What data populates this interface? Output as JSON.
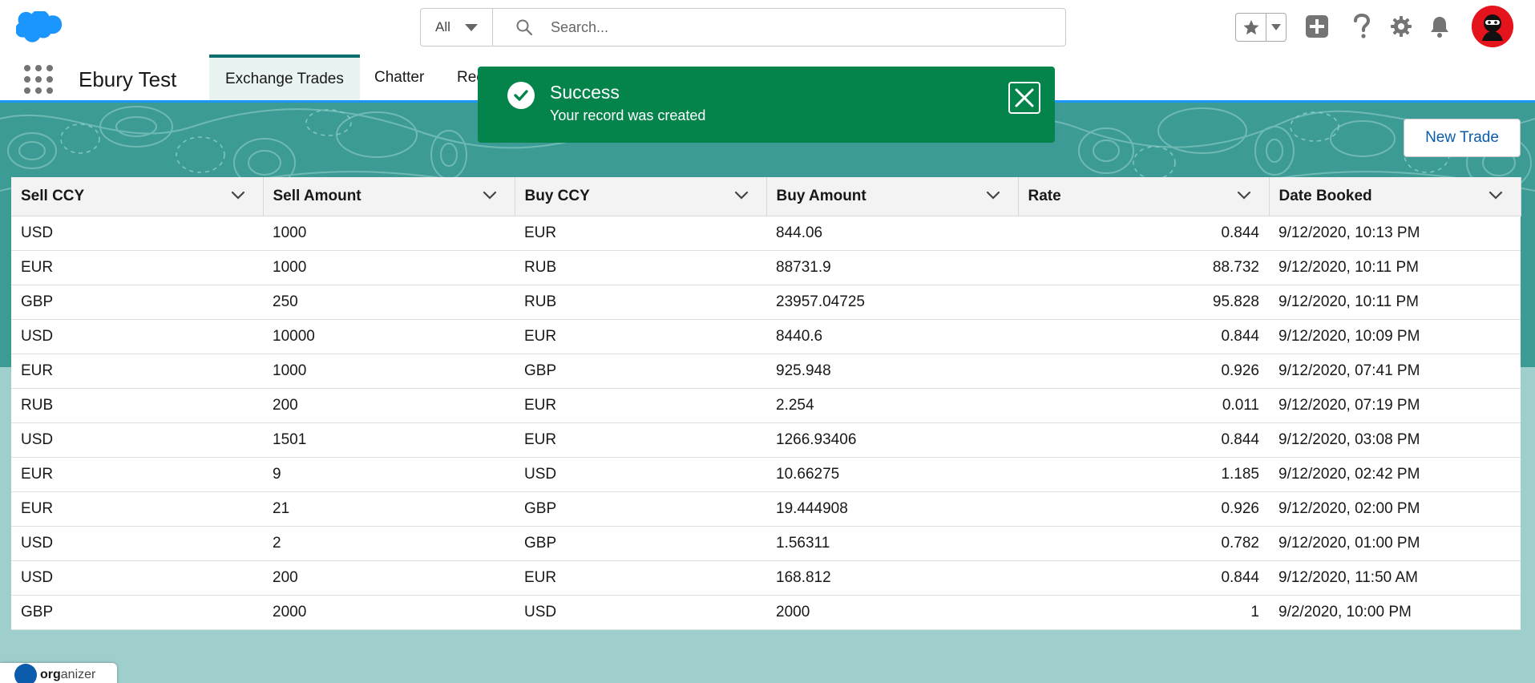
{
  "colors": {
    "brand": "#1b96ff",
    "toast_success": "#04844b",
    "banner": "#3d9b96",
    "page_bg": "#9ecfcc",
    "link": "#0b5cab"
  },
  "header": {
    "search_scope": "All",
    "search_placeholder": "Search...",
    "icons": [
      "favorites-star-icon",
      "add-icon",
      "help-icon",
      "setup-gear-icon",
      "notifications-bell-icon"
    ]
  },
  "app_nav": {
    "app_name": "Ebury Test",
    "tabs": [
      {
        "label": "Exchange Trades",
        "active": true
      },
      {
        "label": "Chatter",
        "active": false
      },
      {
        "label": "Rec",
        "active": false
      }
    ]
  },
  "toast": {
    "title": "Success",
    "message": "Your record was created"
  },
  "actions": {
    "new_trade": "New Trade"
  },
  "table": {
    "columns": [
      "Sell CCY",
      "Sell Amount",
      "Buy CCY",
      "Buy Amount",
      "Rate",
      "Date Booked"
    ],
    "rows": [
      [
        "USD",
        "1000",
        "EUR",
        "844.06",
        "0.844",
        "9/12/2020, 10:13 PM"
      ],
      [
        "EUR",
        "1000",
        "RUB",
        "88731.9",
        "88.732",
        "9/12/2020, 10:11 PM"
      ],
      [
        "GBP",
        "250",
        "RUB",
        "23957.04725",
        "95.828",
        "9/12/2020, 10:11 PM"
      ],
      [
        "USD",
        "10000",
        "EUR",
        "8440.6",
        "0.844",
        "9/12/2020, 10:09 PM"
      ],
      [
        "EUR",
        "1000",
        "GBP",
        "925.948",
        "0.926",
        "9/12/2020, 07:41 PM"
      ],
      [
        "RUB",
        "200",
        "EUR",
        "2.254",
        "0.011",
        "9/12/2020, 07:19 PM"
      ],
      [
        "USD",
        "1501",
        "EUR",
        "1266.93406",
        "0.844",
        "9/12/2020, 03:08 PM"
      ],
      [
        "EUR",
        "9",
        "USD",
        "10.66275",
        "1.185",
        "9/12/2020, 02:42 PM"
      ],
      [
        "EUR",
        "21",
        "GBP",
        "19.444908",
        "0.926",
        "9/12/2020, 02:00 PM"
      ],
      [
        "USD",
        "2",
        "GBP",
        "1.56311",
        "0.782",
        "9/12/2020, 01:00 PM"
      ],
      [
        "USD",
        "200",
        "EUR",
        "168.812",
        "0.844",
        "9/12/2020, 11:50 AM"
      ],
      [
        "GBP",
        "2000",
        "USD",
        "2000",
        "1",
        "9/2/2020, 10:00 PM"
      ]
    ]
  },
  "footer": {
    "organizer_bold": "org",
    "organizer_rest": "anizer"
  }
}
